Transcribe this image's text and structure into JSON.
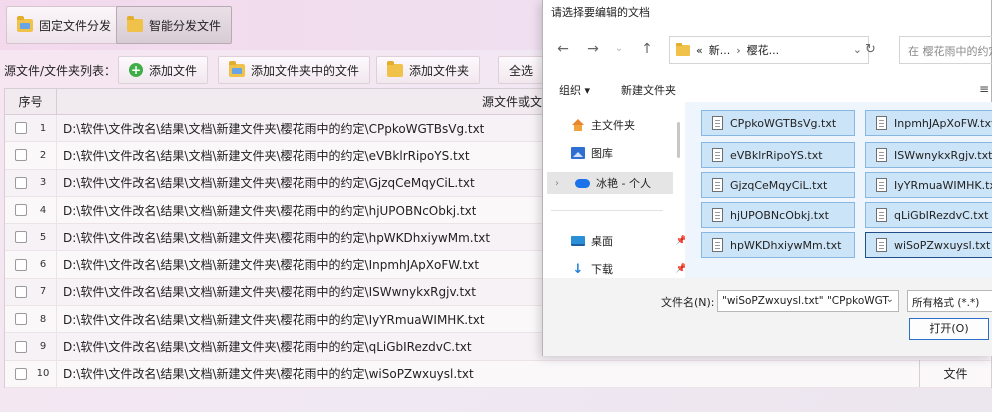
{
  "app": {
    "mode_tabs": [
      "固定文件分发",
      "智能分发文件"
    ],
    "toolbar": {
      "label": "源文件/文件夹列表：",
      "add_file": "添加文件",
      "add_files_in_folder": "添加文件夹中的文件",
      "add_folder": "添加文件夹",
      "clipped_button": "全选"
    },
    "table": {
      "col_index": "序号",
      "col_path": "源文件或文件夹",
      "rows": [
        {
          "n": "1",
          "path": "D:\\软件\\文件改名\\结果\\文档\\新建文件夹\\樱花雨中的约定\\CPpkoWGTBsVg.txt"
        },
        {
          "n": "2",
          "path": "D:\\软件\\文件改名\\结果\\文档\\新建文件夹\\樱花雨中的约定\\eVBklrRipoYS.txt"
        },
        {
          "n": "3",
          "path": "D:\\软件\\文件改名\\结果\\文档\\新建文件夹\\樱花雨中的约定\\GjzqCeMqyCiL.txt"
        },
        {
          "n": "4",
          "path": "D:\\软件\\文件改名\\结果\\文档\\新建文件夹\\樱花雨中的约定\\hjUPOBNcObkj.txt"
        },
        {
          "n": "5",
          "path": "D:\\软件\\文件改名\\结果\\文档\\新建文件夹\\樱花雨中的约定\\hpWKDhxiywMm.txt"
        },
        {
          "n": "6",
          "path": "D:\\软件\\文件改名\\结果\\文档\\新建文件夹\\樱花雨中的约定\\InpmhJApXoFW.txt"
        },
        {
          "n": "7",
          "path": "D:\\软件\\文件改名\\结果\\文档\\新建文件夹\\樱花雨中的约定\\ISWwnykxRgjv.txt"
        },
        {
          "n": "8",
          "path": "D:\\软件\\文件改名\\结果\\文档\\新建文件夹\\樱花雨中的约定\\IyYRmuaWIMHK.txt"
        },
        {
          "n": "9",
          "path": "D:\\软件\\文件改名\\结果\\文档\\新建文件夹\\樱花雨中的约定\\qLiGbIRezdvC.txt"
        },
        {
          "n": "10",
          "path": "D:\\软件\\文件改名\\结果\\文档\\新建文件夹\\樱花雨中的约定\\wiSoPZwxuysl.txt"
        }
      ],
      "last_row_type": "文件"
    }
  },
  "dialog": {
    "title": "请选择要编辑的文档",
    "address": {
      "prefix": "«",
      "part1": "新...",
      "sep": "›",
      "part2": "樱花..."
    },
    "search_placeholder": "在 樱花雨中的约定",
    "cmd_organize": "组织 ▾",
    "cmd_new_folder": "新建文件夹",
    "nav": {
      "home": "主文件夹",
      "pictures": "图库",
      "onedrive": "冰艳 - 个人",
      "desktop": "桌面",
      "downloads": "下载"
    },
    "files": [
      "CPpkoWGTBsVg.txt",
      "InpmhJApXoFW.txt",
      "eVBklrRipoYS.txt",
      "ISWwnykxRgjv.txt",
      "GjzqCeMqyCiL.txt",
      "IyYRmuaWIMHK.txt",
      "hjUPOBNcObkj.txt",
      "qLiGbIRezdvC.txt",
      "hpWKDhxiywMm.txt",
      "wiSoPZwxuysl.txt"
    ],
    "filename_label": "文件名(N):",
    "filename_value": "\"wiSoPZwxuysl.txt\" \"CPpkoWGT",
    "filter": "所有格式 (*.*)",
    "open_button": "打开(O)"
  }
}
